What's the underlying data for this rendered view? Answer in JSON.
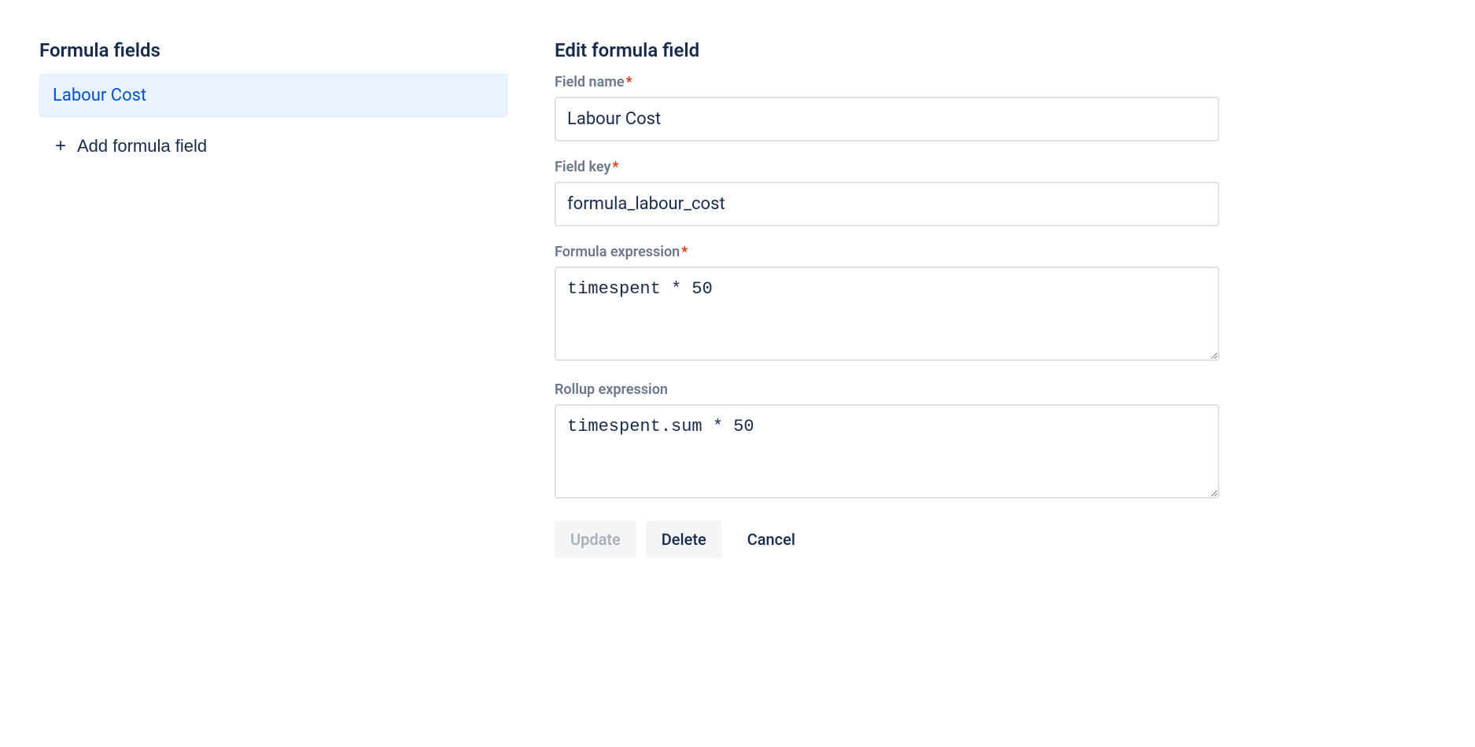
{
  "sidebar": {
    "title": "Formula fields",
    "items": [
      {
        "label": "Labour Cost"
      }
    ],
    "add_button_label": "Add formula field"
  },
  "form": {
    "title": "Edit formula field",
    "fields": {
      "field_name": {
        "label": "Field name",
        "required": true,
        "value": "Labour Cost"
      },
      "field_key": {
        "label": "Field key",
        "required": true,
        "value": "formula_labour_cost"
      },
      "formula_expression": {
        "label": "Formula expression",
        "required": true,
        "value": "timespent * 50"
      },
      "rollup_expression": {
        "label": "Rollup expression",
        "required": false,
        "value": "timespent.sum * 50"
      }
    },
    "buttons": {
      "update": "Update",
      "delete": "Delete",
      "cancel": "Cancel"
    }
  }
}
